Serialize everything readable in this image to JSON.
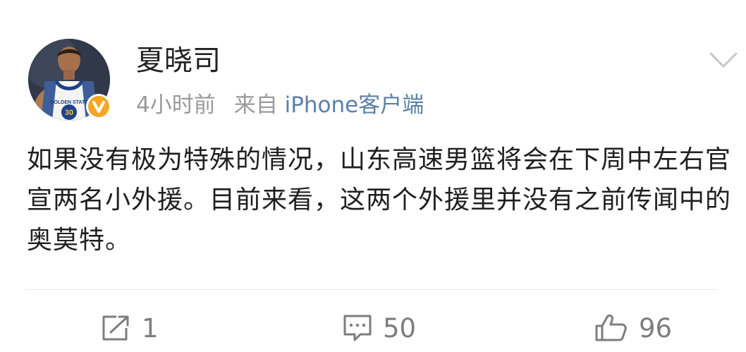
{
  "post": {
    "author": "夏晓司",
    "time": "4小时前",
    "source_prefix": "来自",
    "source_client": "iPhone客户端",
    "text": "如果没有极为特殊的情况，山东高速男篮将会在下周中左右官宣两名小外援。目前来看，这两个外援里并没有之前传闻中的奥莫特。",
    "avatar_text": [
      "GOLDEN STATE",
      "30"
    ]
  },
  "actions": {
    "repost_count": "1",
    "comment_count": "50",
    "like_count": "96"
  },
  "colors": {
    "verified_badge": "#f5a623",
    "client_link": "#5b7fa8",
    "meta_text": "#9a9a9a",
    "action_text": "#7d7d7d"
  },
  "icons": [
    "verified-badge-icon",
    "chevron-down-icon",
    "repost-icon",
    "comment-icon",
    "like-icon"
  ]
}
